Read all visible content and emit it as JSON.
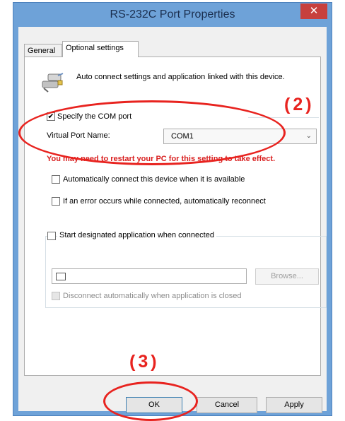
{
  "window": {
    "title": "RS-232C Port Properties",
    "close_glyph": "✕"
  },
  "tabs": [
    {
      "label": "General",
      "selected": false
    },
    {
      "label": "Optional settings",
      "selected": true
    }
  ],
  "description": "Auto connect settings and application linked with this device.",
  "com_port": {
    "checkbox_label": "Specify the COM port",
    "checked": true,
    "virtual_port_label": "Virtual Port Name:",
    "virtual_port_value": "COM1",
    "notice": "You may need to restart your PC for this setting to take effect."
  },
  "auto_connect": {
    "label": "Automatically connect this device when it is available",
    "checked": false
  },
  "auto_reconnect": {
    "label": "If an error occurs while connected, automatically reconnect",
    "checked": false
  },
  "app_group": {
    "checkbox_label": "Start designated application when connected",
    "checked": false,
    "path_value": "",
    "browse_label": "Browse...",
    "disconnect_label": "Disconnect automatically when application is closed"
  },
  "buttons": {
    "ok": "OK",
    "cancel": "Cancel",
    "apply": "Apply"
  },
  "annotations": {
    "step2": "(2)",
    "step3": "(3)",
    "color": "#e8231f"
  },
  "colors": {
    "titlebar": "#6ea2d8",
    "close": "#c7403d"
  }
}
